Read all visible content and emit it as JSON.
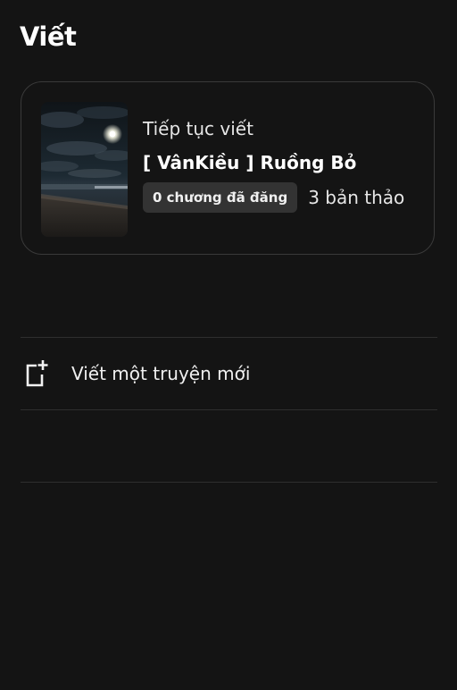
{
  "header": {
    "title": "Viết"
  },
  "current_story": {
    "continue_label": "Tiếp tục viết",
    "title": "[ VânKiều ] Ruồng Bỏ",
    "chapter_badge": "0 chương đã đăng",
    "drafts": "3 bản thảo",
    "cover_icon": "night-moon-sea-cover-image"
  },
  "actions": {
    "new_story_label": "Viết một truyện mới",
    "new_story_icon": "new-document-plus-icon"
  },
  "colors": {
    "background": "#141414",
    "card_border": "#3a3a3a",
    "badge_bg": "#333333",
    "text": "#f2f2f2"
  }
}
